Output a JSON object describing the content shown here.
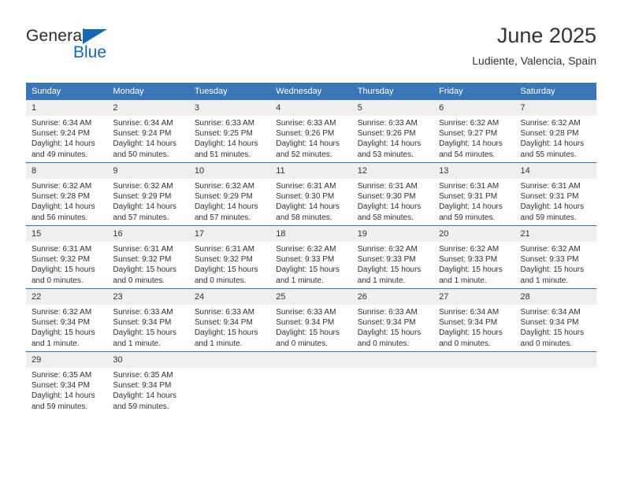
{
  "brand": {
    "name_top": "General",
    "name_bottom": "Blue",
    "triangle_color": "#1668b3"
  },
  "header": {
    "title": "June 2025",
    "subtitle": "Ludiente, Valencia, Spain"
  },
  "theme": {
    "header_bg": "#3b76b8",
    "header_text": "#ffffff",
    "daynum_bg": "#efefef",
    "row_divider": "#2f6ca8",
    "page_bg": "#fdfdfd",
    "body_text": "#333333"
  },
  "columns": [
    "Sunday",
    "Monday",
    "Tuesday",
    "Wednesday",
    "Thursday",
    "Friday",
    "Saturday"
  ],
  "labels": {
    "sunrise": "Sunrise:",
    "sunset": "Sunset:",
    "daylight": "Daylight:"
  },
  "weeks": [
    [
      {
        "day": "1",
        "sunrise": "Sunrise: 6:34 AM",
        "sunset": "Sunset: 9:24 PM",
        "daylight_1": "Daylight: 14 hours",
        "daylight_2": "and 49 minutes."
      },
      {
        "day": "2",
        "sunrise": "Sunrise: 6:34 AM",
        "sunset": "Sunset: 9:24 PM",
        "daylight_1": "Daylight: 14 hours",
        "daylight_2": "and 50 minutes."
      },
      {
        "day": "3",
        "sunrise": "Sunrise: 6:33 AM",
        "sunset": "Sunset: 9:25 PM",
        "daylight_1": "Daylight: 14 hours",
        "daylight_2": "and 51 minutes."
      },
      {
        "day": "4",
        "sunrise": "Sunrise: 6:33 AM",
        "sunset": "Sunset: 9:26 PM",
        "daylight_1": "Daylight: 14 hours",
        "daylight_2": "and 52 minutes."
      },
      {
        "day": "5",
        "sunrise": "Sunrise: 6:33 AM",
        "sunset": "Sunset: 9:26 PM",
        "daylight_1": "Daylight: 14 hours",
        "daylight_2": "and 53 minutes."
      },
      {
        "day": "6",
        "sunrise": "Sunrise: 6:32 AM",
        "sunset": "Sunset: 9:27 PM",
        "daylight_1": "Daylight: 14 hours",
        "daylight_2": "and 54 minutes."
      },
      {
        "day": "7",
        "sunrise": "Sunrise: 6:32 AM",
        "sunset": "Sunset: 9:28 PM",
        "daylight_1": "Daylight: 14 hours",
        "daylight_2": "and 55 minutes."
      }
    ],
    [
      {
        "day": "8",
        "sunrise": "Sunrise: 6:32 AM",
        "sunset": "Sunset: 9:28 PM",
        "daylight_1": "Daylight: 14 hours",
        "daylight_2": "and 56 minutes."
      },
      {
        "day": "9",
        "sunrise": "Sunrise: 6:32 AM",
        "sunset": "Sunset: 9:29 PM",
        "daylight_1": "Daylight: 14 hours",
        "daylight_2": "and 57 minutes."
      },
      {
        "day": "10",
        "sunrise": "Sunrise: 6:32 AM",
        "sunset": "Sunset: 9:29 PM",
        "daylight_1": "Daylight: 14 hours",
        "daylight_2": "and 57 minutes."
      },
      {
        "day": "11",
        "sunrise": "Sunrise: 6:31 AM",
        "sunset": "Sunset: 9:30 PM",
        "daylight_1": "Daylight: 14 hours",
        "daylight_2": "and 58 minutes."
      },
      {
        "day": "12",
        "sunrise": "Sunrise: 6:31 AM",
        "sunset": "Sunset: 9:30 PM",
        "daylight_1": "Daylight: 14 hours",
        "daylight_2": "and 58 minutes."
      },
      {
        "day": "13",
        "sunrise": "Sunrise: 6:31 AM",
        "sunset": "Sunset: 9:31 PM",
        "daylight_1": "Daylight: 14 hours",
        "daylight_2": "and 59 minutes."
      },
      {
        "day": "14",
        "sunrise": "Sunrise: 6:31 AM",
        "sunset": "Sunset: 9:31 PM",
        "daylight_1": "Daylight: 14 hours",
        "daylight_2": "and 59 minutes."
      }
    ],
    [
      {
        "day": "15",
        "sunrise": "Sunrise: 6:31 AM",
        "sunset": "Sunset: 9:32 PM",
        "daylight_1": "Daylight: 15 hours",
        "daylight_2": "and 0 minutes."
      },
      {
        "day": "16",
        "sunrise": "Sunrise: 6:31 AM",
        "sunset": "Sunset: 9:32 PM",
        "daylight_1": "Daylight: 15 hours",
        "daylight_2": "and 0 minutes."
      },
      {
        "day": "17",
        "sunrise": "Sunrise: 6:31 AM",
        "sunset": "Sunset: 9:32 PM",
        "daylight_1": "Daylight: 15 hours",
        "daylight_2": "and 0 minutes."
      },
      {
        "day": "18",
        "sunrise": "Sunrise: 6:32 AM",
        "sunset": "Sunset: 9:33 PM",
        "daylight_1": "Daylight: 15 hours",
        "daylight_2": "and 1 minute."
      },
      {
        "day": "19",
        "sunrise": "Sunrise: 6:32 AM",
        "sunset": "Sunset: 9:33 PM",
        "daylight_1": "Daylight: 15 hours",
        "daylight_2": "and 1 minute."
      },
      {
        "day": "20",
        "sunrise": "Sunrise: 6:32 AM",
        "sunset": "Sunset: 9:33 PM",
        "daylight_1": "Daylight: 15 hours",
        "daylight_2": "and 1 minute."
      },
      {
        "day": "21",
        "sunrise": "Sunrise: 6:32 AM",
        "sunset": "Sunset: 9:33 PM",
        "daylight_1": "Daylight: 15 hours",
        "daylight_2": "and 1 minute."
      }
    ],
    [
      {
        "day": "22",
        "sunrise": "Sunrise: 6:32 AM",
        "sunset": "Sunset: 9:34 PM",
        "daylight_1": "Daylight: 15 hours",
        "daylight_2": "and 1 minute."
      },
      {
        "day": "23",
        "sunrise": "Sunrise: 6:33 AM",
        "sunset": "Sunset: 9:34 PM",
        "daylight_1": "Daylight: 15 hours",
        "daylight_2": "and 1 minute."
      },
      {
        "day": "24",
        "sunrise": "Sunrise: 6:33 AM",
        "sunset": "Sunset: 9:34 PM",
        "daylight_1": "Daylight: 15 hours",
        "daylight_2": "and 1 minute."
      },
      {
        "day": "25",
        "sunrise": "Sunrise: 6:33 AM",
        "sunset": "Sunset: 9:34 PM",
        "daylight_1": "Daylight: 15 hours",
        "daylight_2": "and 0 minutes."
      },
      {
        "day": "26",
        "sunrise": "Sunrise: 6:33 AM",
        "sunset": "Sunset: 9:34 PM",
        "daylight_1": "Daylight: 15 hours",
        "daylight_2": "and 0 minutes."
      },
      {
        "day": "27",
        "sunrise": "Sunrise: 6:34 AM",
        "sunset": "Sunset: 9:34 PM",
        "daylight_1": "Daylight: 15 hours",
        "daylight_2": "and 0 minutes."
      },
      {
        "day": "28",
        "sunrise": "Sunrise: 6:34 AM",
        "sunset": "Sunset: 9:34 PM",
        "daylight_1": "Daylight: 15 hours",
        "daylight_2": "and 0 minutes."
      }
    ],
    [
      {
        "day": "29",
        "sunrise": "Sunrise: 6:35 AM",
        "sunset": "Sunset: 9:34 PM",
        "daylight_1": "Daylight: 14 hours",
        "daylight_2": "and 59 minutes."
      },
      {
        "day": "30",
        "sunrise": "Sunrise: 6:35 AM",
        "sunset": "Sunset: 9:34 PM",
        "daylight_1": "Daylight: 14 hours",
        "daylight_2": "and 59 minutes."
      },
      {
        "day": "",
        "sunrise": "",
        "sunset": "",
        "daylight_1": "",
        "daylight_2": ""
      },
      {
        "day": "",
        "sunrise": "",
        "sunset": "",
        "daylight_1": "",
        "daylight_2": ""
      },
      {
        "day": "",
        "sunrise": "",
        "sunset": "",
        "daylight_1": "",
        "daylight_2": ""
      },
      {
        "day": "",
        "sunrise": "",
        "sunset": "",
        "daylight_1": "",
        "daylight_2": ""
      },
      {
        "day": "",
        "sunrise": "",
        "sunset": "",
        "daylight_1": "",
        "daylight_2": ""
      }
    ]
  ]
}
